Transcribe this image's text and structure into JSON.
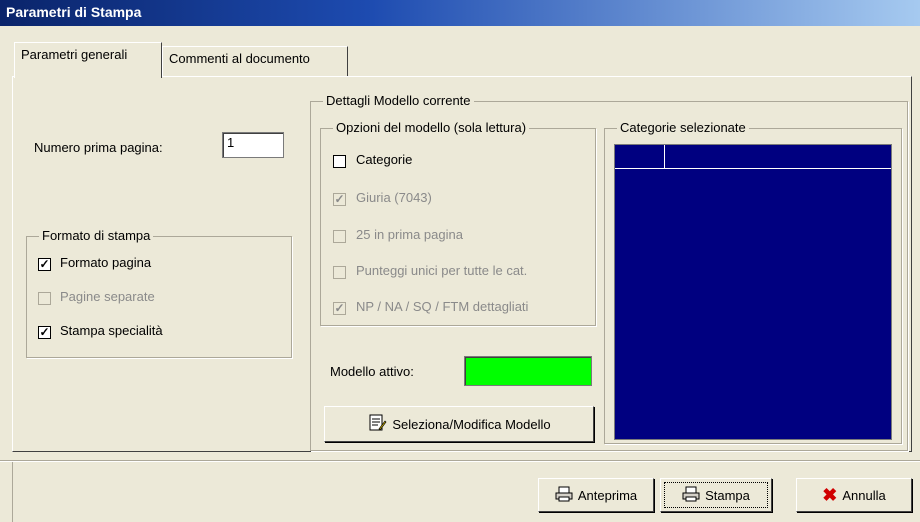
{
  "window": {
    "title": "Parametri di Stampa"
  },
  "tabs": [
    {
      "label": "Parametri generali"
    },
    {
      "label": "Commenti al documento"
    }
  ],
  "general": {
    "first_page_label": "Numero prima pagina:",
    "first_page_value": "1"
  },
  "print_format": {
    "title": "Formato di stampa",
    "items": [
      {
        "label": "Formato pagina",
        "checked": true,
        "enabled": true
      },
      {
        "label": "Pagine separate",
        "checked": false,
        "enabled": false
      },
      {
        "label": "Stampa specialità",
        "checked": true,
        "enabled": true
      }
    ]
  },
  "model_details": {
    "title": "Dettagli Modello corrente",
    "options_title": "Opzioni del modello (sola lettura)",
    "options": [
      {
        "label": "Categorie",
        "checked": false,
        "enabled": true
      },
      {
        "label": "Giuria (7043)",
        "checked": true,
        "enabled": false
      },
      {
        "label": "25 in prima pagina",
        "checked": false,
        "enabled": false
      },
      {
        "label": "Punteggi unici per tutte le cat.",
        "checked": false,
        "enabled": false
      },
      {
        "label": "NP / NA / SQ / FTM dettagliati",
        "checked": true,
        "enabled": false
      }
    ],
    "active_model_label": "Modello attivo:",
    "active_model_color": "#00ff00",
    "select_button_label": "Seleziona/Modifica Modello",
    "categories_title": "Categorie selezionate",
    "list_background": "#000080"
  },
  "footer": {
    "preview_label": "Anteprima",
    "print_label": "Stampa",
    "cancel_label": "Annulla"
  }
}
